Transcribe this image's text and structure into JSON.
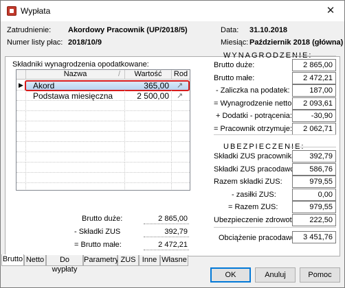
{
  "window": {
    "title": "Wypłata",
    "close_glyph": "✕"
  },
  "header": {
    "employment_label": "Zatrudnienie:",
    "employment_value": "Akordowy Pracownik (UP/2018/5)",
    "list_no_label": "Numer listy płac:",
    "list_no_value": "2018/10/9",
    "date_label": "Data:",
    "date_value": "31.10.2018",
    "month_label": "Miesiąc:",
    "month_value": "Październik 2018 (główna)"
  },
  "left": {
    "section_title": "Składniki wynagrodzenia opodatkowane:",
    "grid": {
      "columns": [
        "Nazwa",
        "Wartość",
        "Rod"
      ],
      "sort_glyph": "/",
      "rows": [
        {
          "name": "Akord",
          "value": "365,00",
          "selected": true
        },
        {
          "name": "Podstawa miesięczna",
          "value": "2 500,00",
          "selected": false
        }
      ],
      "row_marker": "▶",
      "rod_icon": "arrow-icon"
    },
    "summary": {
      "brutto_duze_label": "Brutto duże:",
      "brutto_duze_value": "2 865,00",
      "skladki_zus_label": "- Składki ZUS",
      "skladki_zus_value": "392,79",
      "brutto_male_label": "= Brutto małe:",
      "brutto_male_value": "2 472,21"
    }
  },
  "wynagrodzenie": {
    "title": "WYNAGRODZENIE:",
    "rows": [
      {
        "label": "Brutto duże:",
        "value": "2 865,00"
      },
      {
        "label": "Brutto małe:",
        "value": "2 472,21"
      },
      {
        "label": "- Zaliczka na podatek:",
        "value": "187,00"
      },
      {
        "label": "= Wynagrodzenie netto:",
        "value": "2 093,61"
      },
      {
        "label": "+ Dodatki - potrącenia:",
        "value": "-30,90"
      },
      {
        "label": "= Pracownik otrzymuje:",
        "value": "2 062,71"
      }
    ]
  },
  "ubezpieczenie": {
    "title": "UBEZPIECZENIE:",
    "rows": [
      {
        "label": "Składki ZUS pracownika:",
        "value": "392,79"
      },
      {
        "label": "Składki ZUS pracodawcy:",
        "value": "586,76"
      },
      {
        "label": "Razem składki ZUS:",
        "value": "979,55"
      },
      {
        "label": "- zasiłki ZUS:",
        "value": "0,00"
      },
      {
        "label": "= Razem ZUS:",
        "value": "979,55"
      },
      {
        "label": "Ubezpieczenie zdrowotne:",
        "value": "222,50"
      }
    ],
    "obciazenie_label": "Obciążenie pracodawcy:",
    "obciazenie_value": "3 451,76"
  },
  "tabs": [
    "Brutto",
    "Netto",
    "Do wypłaty",
    "Parametry",
    "ZUS",
    "Inne",
    "Własne"
  ],
  "buttons": {
    "ok": "OK",
    "cancel": "Anuluj",
    "help": "Pomoc"
  },
  "colors": {
    "selection_outline": "#d81b1b",
    "default_button_border": "#0078d7"
  }
}
